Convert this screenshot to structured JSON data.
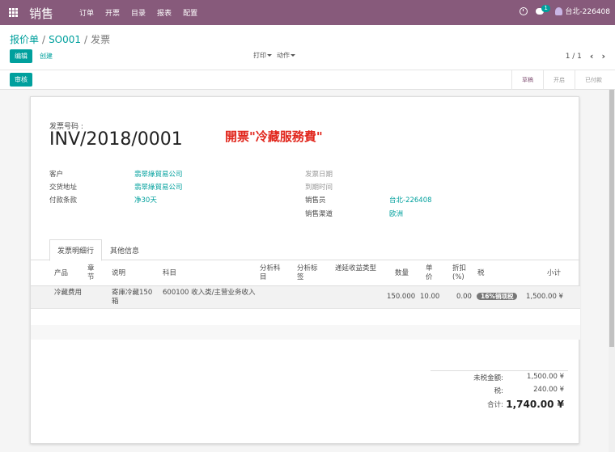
{
  "app": {
    "title": "销售"
  },
  "menu": [
    "订单",
    "开票",
    "目录",
    "报表",
    "配置"
  ],
  "systray": {
    "chat_badge": "1",
    "user": "台北-226408"
  },
  "breadcrumb": {
    "b1": "报价单",
    "b2": "SO001",
    "b3": "发票"
  },
  "buttons": {
    "edit": "编辑",
    "create": "创建",
    "print": "打印",
    "action": "动作",
    "validate": "审核"
  },
  "pager": {
    "value": "1 / 1"
  },
  "stages": [
    "草稿",
    "开启",
    "已付款"
  ],
  "invoice": {
    "label": "发票号码 :",
    "number": "INV/2018/0001",
    "annotation": "開票\"冷藏服務費\""
  },
  "fields_left": [
    {
      "label": "客户",
      "value": "翡翠綠貿易公司"
    },
    {
      "label": "交货地址",
      "value": "翡翠綠貿易公司"
    },
    {
      "label": "付款条款",
      "value": "净30天"
    }
  ],
  "fields_right": [
    {
      "label": "发票日期",
      "value": ""
    },
    {
      "label": "到期时间",
      "value": ""
    },
    {
      "label": "销售员",
      "value": "台北-226408"
    },
    {
      "label": "销售渠道",
      "value": "欧洲"
    }
  ],
  "tabs": [
    "发票明细行",
    "其他信息"
  ],
  "columns": {
    "product": "产品",
    "section": "章节",
    "desc": "说明",
    "account": "科目",
    "analytic_account": "分析科目",
    "analytic_tags": "分析标签",
    "deferred": "递延收益类型",
    "qty": "数量",
    "price": "单价",
    "discount": "折扣 (%)",
    "tax": "税",
    "subtotal": "小计"
  },
  "lines": [
    {
      "product": "冷藏费用",
      "desc": "寄庫冷藏150箱",
      "account": "600100 收入类/主营业务收入",
      "qty": "150.000",
      "price": "10.00",
      "discount": "0.00",
      "tax": "16%销项税",
      "subtotal": "1,500.00 ¥"
    }
  ],
  "totals": {
    "untaxed_label": "未税金额:",
    "untaxed": "1,500.00 ¥",
    "tax_label": "税:",
    "tax": "240.00 ¥",
    "total_label": "合计:",
    "total": "1,740.00 ¥"
  }
}
